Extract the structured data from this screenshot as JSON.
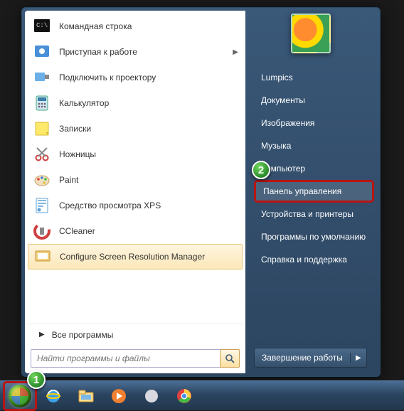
{
  "programs": [
    {
      "label": "Командная строка",
      "icon": "cmd",
      "expand": false
    },
    {
      "label": "Приступая к работе",
      "icon": "getting-started",
      "expand": true
    },
    {
      "label": "Подключить к проектору",
      "icon": "projector",
      "expand": false
    },
    {
      "label": "Калькулятор",
      "icon": "calculator",
      "expand": false
    },
    {
      "label": "Записки",
      "icon": "notes",
      "expand": false
    },
    {
      "label": "Ножницы",
      "icon": "snip",
      "expand": false
    },
    {
      "label": "Paint",
      "icon": "paint",
      "expand": false
    },
    {
      "label": "Средство просмотра XPS",
      "icon": "xps",
      "expand": false
    },
    {
      "label": "CCleaner",
      "icon": "ccleaner",
      "expand": false
    },
    {
      "label": "Configure Screen Resolution Manager",
      "icon": "csrm",
      "expand": false,
      "highlighted": true
    }
  ],
  "all_programs_label": "Все программы",
  "search": {
    "placeholder": "Найти программы и файлы"
  },
  "right_items": [
    {
      "label": "Lumpics"
    },
    {
      "label": "Документы"
    },
    {
      "label": "Изображения"
    },
    {
      "label": "Музыка"
    },
    {
      "label": "Компьютер"
    },
    {
      "label": "Панель управления",
      "highlighted": true
    },
    {
      "label": "Устройства и принтеры"
    },
    {
      "label": "Программы по умолчанию"
    },
    {
      "label": "Справка и поддержка"
    }
  ],
  "shutdown_label": "Завершение работы",
  "taskbar_icons": [
    "ie",
    "explorer",
    "wmp",
    "blank",
    "chrome"
  ],
  "badges": {
    "one": "1",
    "two": "2"
  }
}
